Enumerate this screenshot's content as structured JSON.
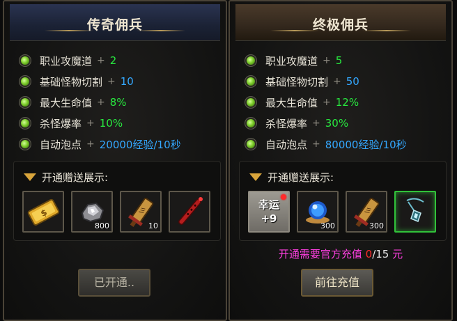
{
  "left": {
    "title": "传奇佣兵",
    "stats": [
      {
        "label": "职业攻魔道",
        "value": "2",
        "color": "green"
      },
      {
        "label": "基础怪物切割",
        "value": "10",
        "color": "blue"
      },
      {
        "label": "最大生命值",
        "value": "8%",
        "color": "green"
      },
      {
        "label": "杀怪爆率",
        "value": "10%",
        "color": "green"
      },
      {
        "label": "自动泡点",
        "value": "20000经验/10秒",
        "color": "blue"
      }
    ],
    "gift_title": "开通赠送展示:",
    "items": [
      {
        "icon": "gold-ticket-icon",
        "qty": ""
      },
      {
        "icon": "ore-icon",
        "qty": "800"
      },
      {
        "icon": "scroll-blade-icon",
        "qty": "10"
      },
      {
        "icon": "red-flute-icon",
        "qty": ""
      }
    ],
    "button_label": "已开通.."
  },
  "right": {
    "title": "终极佣兵",
    "stats": [
      {
        "label": "职业攻魔道",
        "value": "5",
        "color": "green"
      },
      {
        "label": "基础怪物切割",
        "value": "50",
        "color": "blue"
      },
      {
        "label": "最大生命值",
        "value": "12%",
        "color": "green"
      },
      {
        "label": "杀怪爆率",
        "value": "30%",
        "color": "green"
      },
      {
        "label": "自动泡点",
        "value": "80000经验/10秒",
        "color": "blue"
      }
    ],
    "gift_title": "开通赠送展示:",
    "items": [
      {
        "icon": "luck-stone-icon",
        "qty": "",
        "line1": "幸运",
        "line2": "+9"
      },
      {
        "icon": "blue-orb-icon",
        "qty": "300"
      },
      {
        "icon": "scroll-blade-icon",
        "qty": "300"
      },
      {
        "icon": "amulet-icon",
        "qty": ""
      }
    ],
    "recharge": {
      "prefix": "开通需要官方充值",
      "current": "0",
      "separator": "/",
      "target": "15",
      "unit": "元"
    },
    "button_label": "前往充值"
  },
  "plus_sign": "+",
  "colors": {
    "green": "#28e83f",
    "blue": "#34a8ff",
    "magenta": "#ff3fe1",
    "red": "#ff2b2b"
  }
}
